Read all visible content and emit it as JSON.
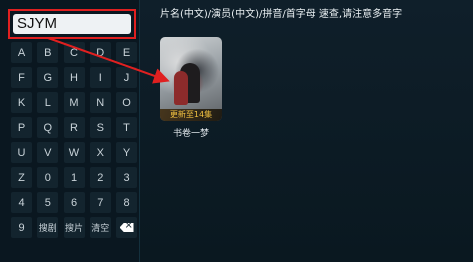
{
  "search": {
    "query": "SJYM"
  },
  "keyboard": {
    "rows": [
      [
        "A",
        "B",
        "C",
        "D",
        "E"
      ],
      [
        "F",
        "G",
        "H",
        "I",
        "J"
      ],
      [
        "K",
        "L",
        "M",
        "N",
        "O"
      ],
      [
        "P",
        "Q",
        "R",
        "S",
        "T"
      ],
      [
        "U",
        "V",
        "W",
        "X",
        "Y"
      ],
      [
        "Z",
        "0",
        "1",
        "2",
        "3"
      ],
      [
        "4",
        "5",
        "6",
        "7",
        "8"
      ]
    ],
    "bottom_row": {
      "nine": "9",
      "search_label": "搜剧",
      "film_label": "搜片",
      "clear_label": "清空"
    },
    "delete_icon": "backspace-icon"
  },
  "hint": "片名(中文)/演员(中文)/拼音/首字母 速查,请注意多音字",
  "result": {
    "title": "书卷一梦",
    "badge": "更新至14集"
  },
  "annotation_color": "#e02020"
}
